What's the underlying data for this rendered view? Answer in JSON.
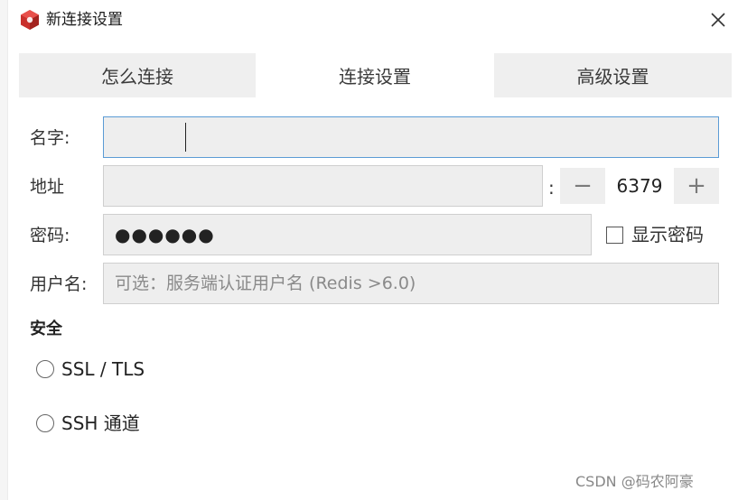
{
  "window": {
    "title": "新连接设置"
  },
  "tabs": [
    {
      "label": "怎么连接",
      "active": false
    },
    {
      "label": "连接设置",
      "active": true
    },
    {
      "label": "高级设置",
      "active": false
    }
  ],
  "form": {
    "name": {
      "label": "名字:",
      "value": ""
    },
    "address": {
      "label": "地址",
      "value": "",
      "colon": ":"
    },
    "port": {
      "value": "6379",
      "decrement": "−",
      "increment": "+"
    },
    "password": {
      "label": "密码:",
      "value": "●●●●●●"
    },
    "show_password": {
      "label": "显示密码",
      "checked": false
    },
    "username": {
      "label": "用户名:",
      "placeholder": "可选：服务端认证用户名 (Redis >6.0)",
      "value": ""
    }
  },
  "security": {
    "title": "安全",
    "options": [
      {
        "label": "SSL / TLS",
        "selected": false
      },
      {
        "label": "SSH 通道",
        "selected": false
      }
    ]
  },
  "watermark": "CSDN @码农阿豪",
  "colors": {
    "accent_focus": "#5b9bd5",
    "tab_inactive": "#efefef",
    "field_bg": "#eeeeee",
    "app_icon": "#c9302c"
  },
  "icons": {
    "app": "redis-cube-icon",
    "close": "close-icon"
  }
}
